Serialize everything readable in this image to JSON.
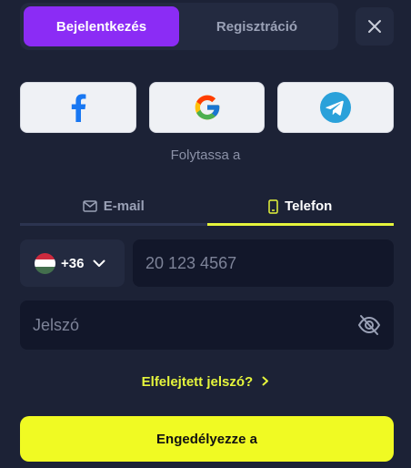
{
  "auth_tabs": [
    {
      "label": "Bejelentkezés",
      "active": true
    },
    {
      "label": "Regisztráció",
      "active": false
    }
  ],
  "social_login": {
    "providers": [
      "facebook-icon",
      "google-icon",
      "telegram-icon"
    ],
    "continue_text": "Folytassa a"
  },
  "method_tabs": [
    {
      "label": "E-mail",
      "icon": "envelope-icon",
      "active": false
    },
    {
      "label": "Telefon",
      "icon": "phone-icon",
      "active": true
    }
  ],
  "phone": {
    "country_flag": "hungary-flag-icon",
    "dial_code": "+36",
    "placeholder": "20 123 4567"
  },
  "password": {
    "placeholder": "Jelszó"
  },
  "forgot_password_label": "Elfelejtett jelszó?",
  "submit_label": "Engedélyezze a",
  "colors": {
    "background": "#1c2236",
    "active_tab": "#8b2cf5",
    "accent_yellow": "#f0fa23"
  }
}
